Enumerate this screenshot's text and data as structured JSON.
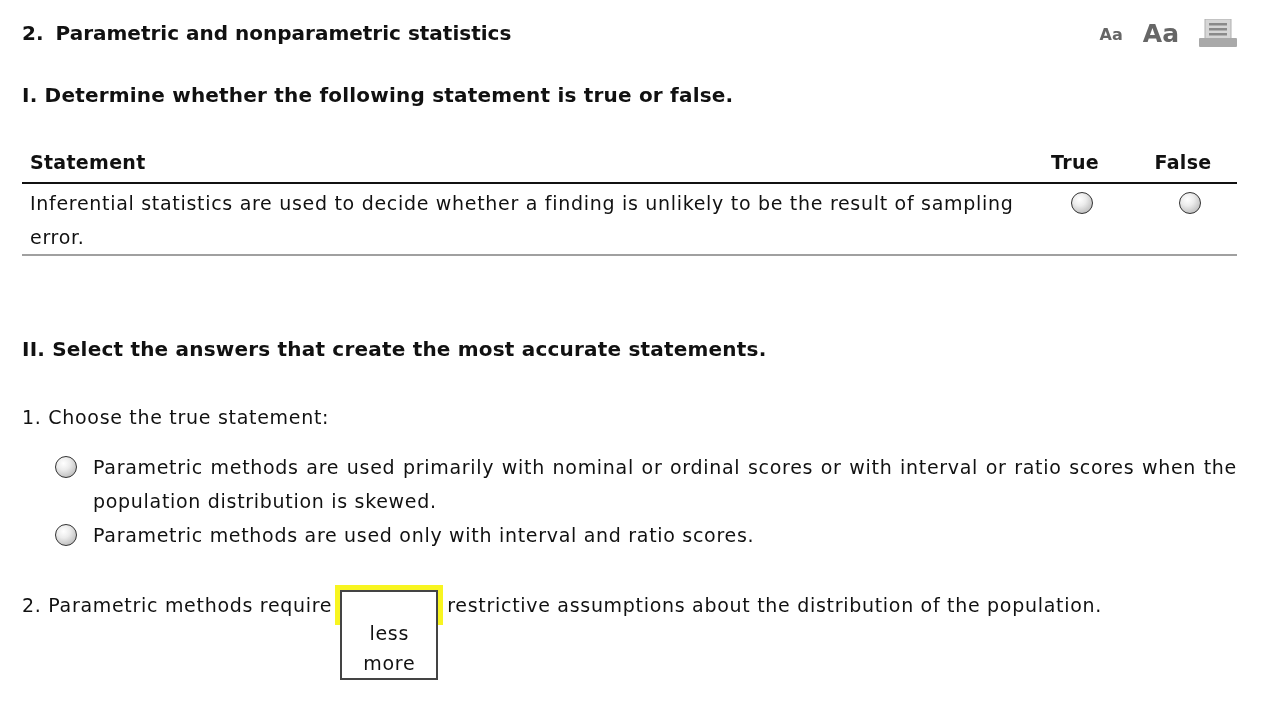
{
  "header": {
    "number": "2.",
    "title": "Parametric and nonparametric statistics",
    "tools": [
      {
        "kind": "text_small",
        "label": "Aa"
      },
      {
        "kind": "text_large",
        "label": "Aa"
      },
      {
        "kind": "print"
      }
    ]
  },
  "part_1": {
    "heading": "I. Determine whether the following statement is true or false.",
    "columns": [
      "Statement",
      "True",
      "False"
    ],
    "rows": [
      {
        "statement": "Inferential statistics are used to decide whether a finding is unlikely to be the result of sampling error.",
        "choices": [
          {
            "selected": false
          },
          {
            "selected": false
          }
        ]
      }
    ]
  },
  "part_2": {
    "heading": "II. Select the answers that create the most accurate statements.",
    "questions": [
      {
        "kind": "choice",
        "prompt": "1. Choose the true statement:",
        "options": [
          {
            "text": "Parametric methods are used primarily with nominal or ordinal scores or with interval or ratio scores when the population distribution is skewed.",
            "selected": false
          },
          {
            "text": "Parametric methods are used only with interval and ratio scores.",
            "selected": false
          }
        ]
      },
      {
        "kind": "dropdown",
        "before": "2. Parametric methods require",
        "after": "restrictive assumptions about the distribution of the population.",
        "dropdown": {
          "focused": true,
          "expanded": true,
          "options": [
            "less",
            "more"
          ]
        }
      }
    ]
  }
}
